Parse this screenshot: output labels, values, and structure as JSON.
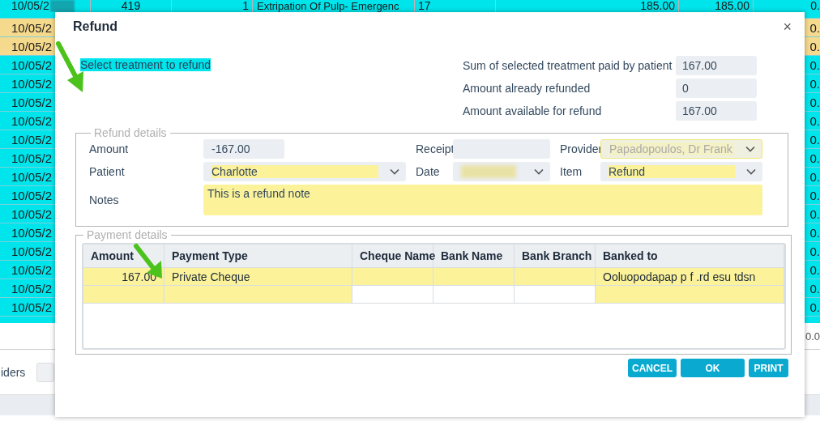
{
  "background_table": {
    "rows": [
      {
        "date": "10/05/2",
        "redacted": true,
        "cells": [
          "419",
          "1",
          "Extripation Of Pulp- Emergenc",
          "17"
        ],
        "amounts": [
          "185.00",
          "185.00"
        ],
        "tail": "0.",
        "highlighted": false
      },
      {
        "date": "10/05/2",
        "tail": "0.",
        "highlighted": true
      },
      {
        "date": "10/05/2",
        "tail": "0.",
        "highlighted": true
      },
      {
        "date": "10/05/2",
        "tail": "0.",
        "highlighted": false
      },
      {
        "date": "10/05/2",
        "tail": "0.",
        "highlighted": false
      },
      {
        "date": "10/05/2",
        "tail": "0.",
        "highlighted": false
      },
      {
        "date": "10/05/2",
        "tail": "0.",
        "highlighted": false
      },
      {
        "date": "10/05/2",
        "tail": "0.",
        "highlighted": false
      },
      {
        "date": "10/05/2",
        "tail": "0.",
        "highlighted": false
      },
      {
        "date": "10/05/2",
        "tail": "0.",
        "highlighted": false
      },
      {
        "date": "10/05/2",
        "tail": "0.",
        "highlighted": false
      },
      {
        "date": "10/05/2",
        "tail": "0.",
        "highlighted": false
      },
      {
        "date": "10/05/2",
        "tail": "0.",
        "highlighted": false
      },
      {
        "date": "10/05/2",
        "tail": "0.",
        "highlighted": false
      },
      {
        "date": "10/05/2",
        "tail": "0.",
        "highlighted": false
      },
      {
        "date": "10/05/2",
        "tail": "0.",
        "highlighted": false
      },
      {
        "date": "10/05/2",
        "tail": "0.",
        "highlighted": false
      }
    ],
    "total": "0.0",
    "filter_label": "iders"
  },
  "dialog": {
    "title": "Refund",
    "close": "×",
    "prompt": "Select treatment to refund",
    "summary": [
      {
        "label": "Sum of selected treatment paid by patient",
        "value": "167.00"
      },
      {
        "label": "Amount already refunded",
        "value": "0"
      },
      {
        "label": "Amount available for refund",
        "value": "167.00"
      }
    ],
    "refund_details": {
      "legend": "Refund details",
      "fields": [
        {
          "label": "Amount",
          "kind": "text",
          "value": "-167.00",
          "disabled": false
        },
        {
          "label": "Receipt",
          "kind": "text",
          "disabled": false
        },
        {
          "label": "Provider",
          "kind": "select",
          "value": "Papadopoulos, Dr Frank",
          "disabled": true
        },
        {
          "label": "Patient",
          "kind": "select",
          "value": "Charlotte",
          "disabled": false
        },
        {
          "label": "Date",
          "kind": "select",
          "redacted": true,
          "disabled": false
        },
        {
          "label": "Item",
          "kind": "select",
          "value": "Refund",
          "disabled": false
        }
      ],
      "notes": {
        "label": "Notes",
        "value": "This is a refund note"
      }
    },
    "payment_details": {
      "legend": "Payment details",
      "columns": [
        "Amount",
        "Payment Type",
        "Cheque Name",
        "Bank Name",
        "Bank Branch",
        "Banked to"
      ],
      "rows": [
        {
          "kind": "entry",
          "amount": "167.00",
          "payment_type": "Private Cheque",
          "banked_to": "Ooluopodapap p f .rd esu tdsn"
        },
        {
          "kind": "new"
        }
      ]
    },
    "buttons": [
      "CANCEL",
      "OK",
      "PRINT"
    ]
  }
}
